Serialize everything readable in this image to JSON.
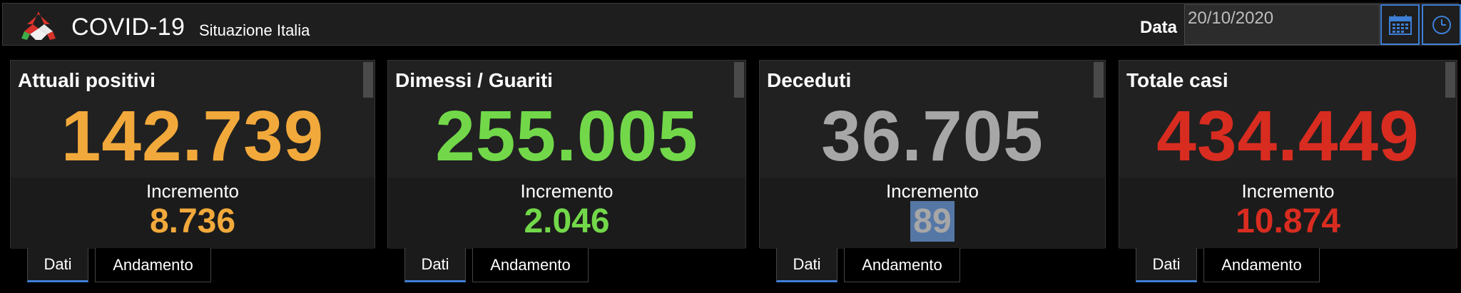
{
  "header": {
    "title": "COVID-19",
    "subtitle": "Situazione Italia",
    "date_label": "Data",
    "date_value": "20/10/2020",
    "icons": {
      "logo": "italy-logo-icon",
      "calendar": "calendar-icon",
      "clock": "clock-icon"
    }
  },
  "tabs": {
    "data_label": "Dati",
    "trend_label": "Andamento"
  },
  "cards": [
    {
      "title": "Attuali positivi",
      "value": "142.739",
      "increment_label": "Incremento",
      "increment_value": "8.736",
      "color": "#f2a93b"
    },
    {
      "title": "Dimessi / Guariti",
      "value": "255.005",
      "increment_label": "Incremento",
      "increment_value": "2.046",
      "color": "#72d84a"
    },
    {
      "title": "Deceduti",
      "value": "36.705",
      "increment_label": "Incremento",
      "increment_value": "89",
      "color": "#a7a7a7"
    },
    {
      "title": "Totale casi",
      "value": "434.449",
      "increment_label": "Incremento",
      "increment_value": "10.874",
      "color": "#d92c20"
    }
  ],
  "colors": {
    "accent": "#3d7fd6",
    "panel": "#202020",
    "background": "#000000"
  }
}
